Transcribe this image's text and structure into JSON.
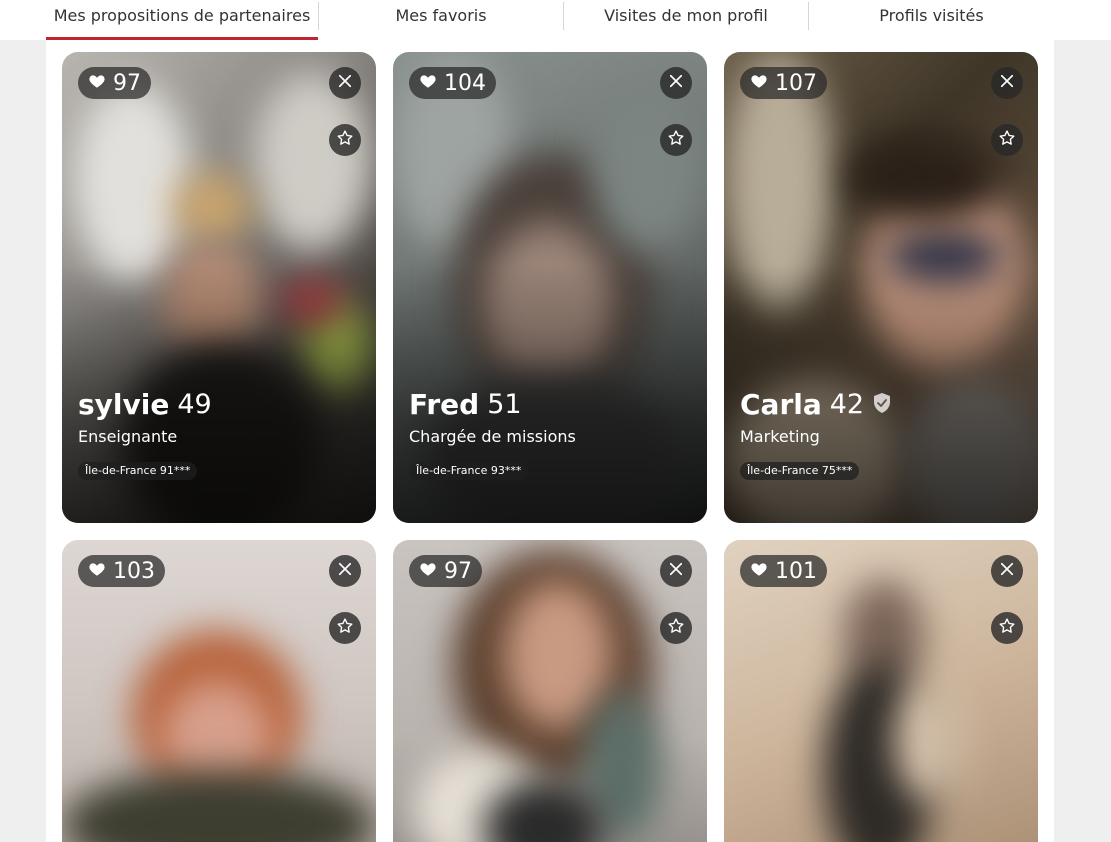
{
  "tabs": [
    {
      "label": "Mes propositions de partenaires"
    },
    {
      "label": "Mes favoris"
    },
    {
      "label": "Visites de mon profil"
    },
    {
      "label": "Profils visités"
    }
  ],
  "accent_color": "#c0242f",
  "profiles": [
    {
      "likes": "97",
      "name": "sylvie",
      "age": "49",
      "job": "Enseignante",
      "location": "Île-de-France 91***"
    },
    {
      "likes": "104",
      "name": "Fred",
      "age": "51",
      "job": "Chargée de missions",
      "location": "Île-de-France 93***"
    },
    {
      "likes": "107",
      "name": "Carla",
      "age": "42",
      "job": "Marketing",
      "location": "Île-de-France 75***",
      "verified": true
    },
    {
      "likes": "103"
    },
    {
      "likes": "97"
    },
    {
      "likes": "101"
    }
  ],
  "icons": {
    "likes": "heart-icon",
    "close": "close-icon",
    "favorite": "star-icon",
    "verified": "shield-check-icon"
  }
}
